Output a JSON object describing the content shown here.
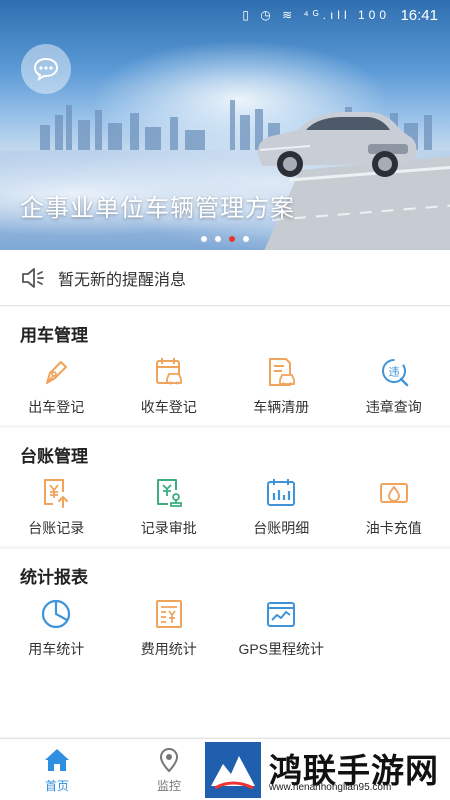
{
  "status_bar": {
    "time": "16:41",
    "icons": "▯ ◷ ≋ ⁴ᴳ.ıll 100"
  },
  "banner": {
    "title": "企事业单位车辆管理方案",
    "dots": 4,
    "active_dot": 3
  },
  "notice": {
    "text": "暂无新的提醒消息"
  },
  "sections": [
    {
      "title": "用车管理",
      "items": [
        {
          "label": "出车登记",
          "icon": "pen-nib-icon"
        },
        {
          "label": "收车登记",
          "icon": "calendar-car-icon"
        },
        {
          "label": "车辆清册",
          "icon": "document-car-icon"
        },
        {
          "label": "违章查询",
          "icon": "violation-search-icon"
        }
      ]
    },
    {
      "title": "台账管理",
      "items": [
        {
          "label": "台账记录",
          "icon": "yen-upload-icon"
        },
        {
          "label": "记录审批",
          "icon": "document-approval-icon"
        },
        {
          "label": "台账明细",
          "icon": "calendar-bars-icon"
        },
        {
          "label": "油卡充值",
          "icon": "fuel-card-icon"
        }
      ]
    },
    {
      "title": "统计报表",
      "items": [
        {
          "label": "用车统计",
          "icon": "pie-chart-icon"
        },
        {
          "label": "费用统计",
          "icon": "expense-list-icon"
        },
        {
          "label": "GPS里程统计",
          "icon": "line-chart-icon"
        }
      ]
    }
  ],
  "bottom_nav": [
    {
      "label": "首页",
      "icon": "home-icon",
      "active": true
    },
    {
      "label": "监控",
      "icon": "location-pin-icon",
      "active": false
    }
  ],
  "watermark": {
    "title": "鸿联手游网",
    "url": "www.henanhonglian95.com"
  },
  "colors": {
    "accent_orange": "#f0a35b",
    "accent_blue": "#3f93d8",
    "nav_active": "#2f8fe0",
    "nav_inactive": "#777777",
    "dot_active": "#e23b2e"
  }
}
